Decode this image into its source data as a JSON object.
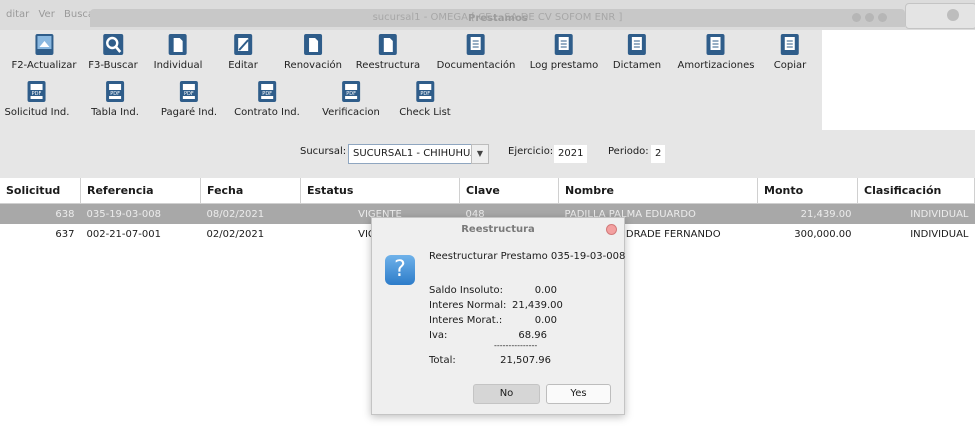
{
  "background_window": {
    "menu": [
      "ditar",
      "Ver",
      "Busca"
    ],
    "title": "sucursal1 - OMEGA [ CE... SA DE CV SOFOM ENR ]"
  },
  "window_title": "Prestamos",
  "toolbar": {
    "row1": [
      {
        "label": "F2-Actualizar",
        "icon": "refresh-icon"
      },
      {
        "label": "F3-Buscar",
        "icon": "search-icon"
      },
      {
        "label": "Individual",
        "icon": "document-icon"
      },
      {
        "label": "Editar",
        "icon": "edit-icon"
      },
      {
        "label": "Renovación",
        "icon": "document-icon"
      },
      {
        "label": "Reestructura",
        "icon": "document-icon"
      },
      {
        "label": "Documentación",
        "icon": "report-icon"
      },
      {
        "label": "Log prestamo",
        "icon": "report-icon"
      },
      {
        "label": "Dictamen",
        "icon": "report-icon"
      },
      {
        "label": "Amortizaciones",
        "icon": "report-icon"
      },
      {
        "label": "Copiar",
        "icon": "report-icon"
      }
    ],
    "row2": [
      {
        "label": "Solicitud Ind.",
        "icon": "pdf-icon"
      },
      {
        "label": "Tabla Ind.",
        "icon": "pdf-icon"
      },
      {
        "label": "Pagaré Ind.",
        "icon": "pdf-icon"
      },
      {
        "label": "Contrato Ind.",
        "icon": "pdf-icon"
      },
      {
        "label": "Verificacion",
        "icon": "pdf-icon"
      },
      {
        "label": "Check List",
        "icon": "pdf-icon"
      }
    ]
  },
  "filters": {
    "sucursal_label": "Sucursal:",
    "sucursal_value": "SUCURSAL1 - CHIHUHUA",
    "ejercicio_label": "Ejercicio:",
    "ejercicio_value": "2021",
    "periodo_label": "Periodo:",
    "periodo_value": "2"
  },
  "table": {
    "columns": [
      "Solicitud",
      "Referencia",
      "Fecha",
      "Estatus",
      "Clave",
      "Nombre",
      "Monto",
      "Clasificación"
    ],
    "rows": [
      {
        "solicitud": "638",
        "referencia": "035-19-03-008",
        "fecha": "08/02/2021",
        "estatus": "VIGENTE",
        "clave": "048",
        "nombre": "PADILLA PALMA EDUARDO",
        "monto": "21,439.00",
        "clasificacion": "INDIVIDUAL"
      },
      {
        "solicitud": "637",
        "referencia": "002-21-07-001",
        "fecha": "02/02/2021",
        "estatus": "VIGENTE",
        "clave": "",
        "nombre": "TREVIZO ANDRADE FERNANDO",
        "monto": "300,000.00",
        "clasificacion": "INDIVIDUAL"
      }
    ]
  },
  "dialog": {
    "title": "Reestructura",
    "message": "Reestructurar Prestamo 035-19-03-008",
    "icon": "question-icon",
    "lines": [
      {
        "label": "Saldo Insoluto:",
        "value": "0.00"
      },
      {
        "label": "Interes Normal:",
        "value": "21,439.00"
      },
      {
        "label": "Interes Morat.:",
        "value": "0.00"
      },
      {
        "label": "Iva:",
        "value": "68.96"
      }
    ],
    "separator": "---------------",
    "total_label": "Total:",
    "total_value": "21,507.96",
    "no_label": "No",
    "yes_label": "Yes"
  },
  "colors": {
    "toolbar_bg": "#e6e6e6",
    "selected_row": "#a8a8a8",
    "icon_blue": "#2f5d8a"
  }
}
